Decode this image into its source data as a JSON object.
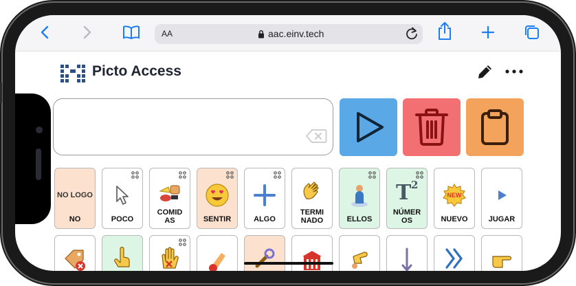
{
  "browser": {
    "text_size_label": "AA",
    "url": "aac.einv.tech"
  },
  "app": {
    "title": "Picto Access"
  },
  "message": {
    "text": ""
  },
  "tiles_row1": [
    {
      "label": "NO",
      "image_text": "NO LOGO",
      "bg": "#fde1cf",
      "folder": false
    },
    {
      "label": "POCO",
      "bg": "#ffffff",
      "folder": true
    },
    {
      "label": "COMID AS",
      "bg": "#ffffff",
      "folder": true
    },
    {
      "label": "SENTIR",
      "bg": "#fde1cf",
      "folder": true
    },
    {
      "label": "ALGO",
      "bg": "#ffffff",
      "folder": true
    },
    {
      "label": "TERMI NADO",
      "bg": "#ffffff",
      "folder": false
    },
    {
      "label": "ELLOS",
      "bg": "#dcf5e4",
      "folder": true
    },
    {
      "label": "NÚMER OS",
      "bg": "#dcf5e4",
      "folder": true
    },
    {
      "label": "NUEVO",
      "bg": "#ffffff",
      "folder": false
    },
    {
      "label": "JUGAR",
      "bg": "#ffffff",
      "folder": false
    }
  ],
  "tiles_row2": [
    {
      "bg": "#ffffff",
      "folder": false
    },
    {
      "bg": "#dcf5e4",
      "folder": false
    },
    {
      "bg": "#ffffff",
      "folder": true
    },
    {
      "bg": "#ffffff",
      "folder": false
    },
    {
      "bg": "#fde1cf",
      "folder": false
    },
    {
      "bg": "#ffffff",
      "folder": false
    },
    {
      "bg": "#ffffff",
      "folder": false
    },
    {
      "bg": "#ffffff",
      "folder": false
    },
    {
      "bg": "#ffffff",
      "folder": false
    },
    {
      "bg": "#ffffff",
      "folder": false
    }
  ],
  "colors": {
    "speak": "#5aa9e6",
    "clear": "#f27071",
    "copy": "#f3a35c",
    "ios_blue": "#1e7cf2"
  }
}
